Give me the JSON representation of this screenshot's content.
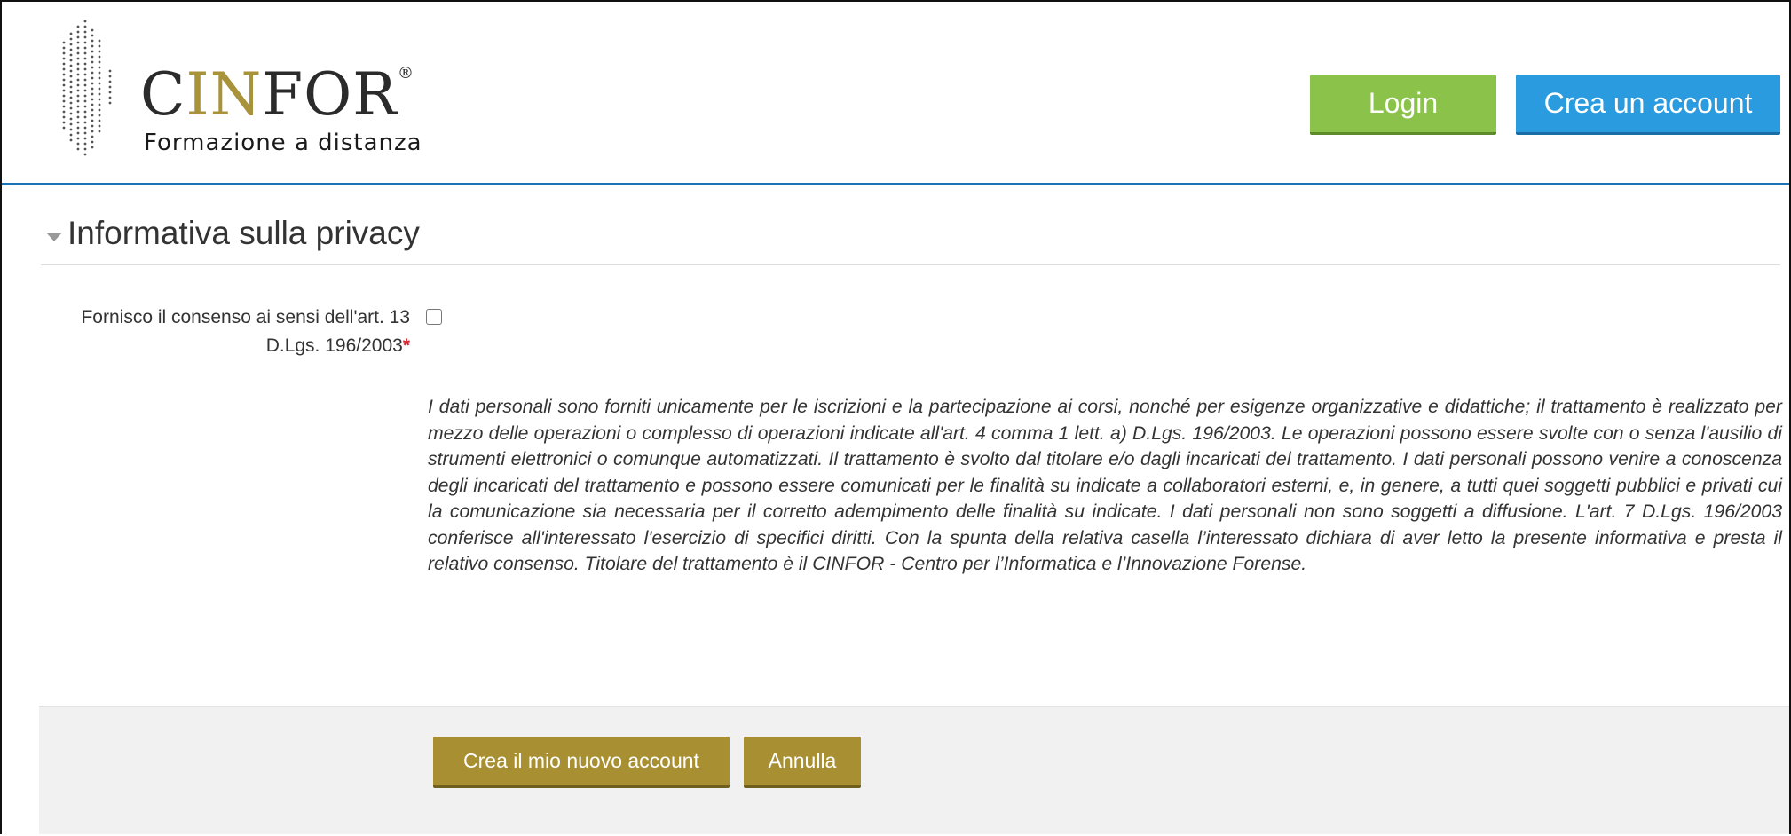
{
  "header": {
    "brand": {
      "name_part1": "C",
      "name_gold": "IN",
      "name_part2": "FOR",
      "registered": "®",
      "tagline": "Formazione a distanza"
    },
    "login_label": "Login",
    "create_account_label": "Crea un account"
  },
  "section": {
    "title": "Informativa sulla privacy"
  },
  "consent": {
    "label": "Fornisco il consenso ai sensi dell'art. 13 D.Lgs. 196/2003",
    "required_mark": "*",
    "checked": false
  },
  "policy_text": "I dati personali sono forniti unicamente per le iscrizioni e la partecipazione ai corsi, nonché per esigenze organizzative e didattiche; il trattamento è realizzato per mezzo delle operazioni o complesso di operazioni indicate all'art. 4 comma 1 lett. a) D.Lgs. 196/2003. Le operazioni possono essere svolte con o senza l'ausilio di strumenti elettronici o comunque automatizzati. Il trattamento è svolto dal titolare e/o dagli incaricati del trattamento. I dati personali possono venire a conoscenza degli incaricati del trattamento e possono essere comunicati per le finalità su indicate a collaboratori esterni, e, in genere, a tutti quei soggetti pubblici e privati cui la comunicazione sia necessaria per il corretto adempimento delle finalità su indicate. I dati personali non sono soggetti a diffusione. L'art. 7 D.Lgs. 196/2003 conferisce all'interessato l'esercizio di specifici diritti. Con la spunta della relativa casella l’interessato dichiara di aver letto la presente informativa e presta il relativo consenso. Titolare del trattamento è il CINFOR - Centro per l’Informatica e l’Innovazione Forense.",
  "actions": {
    "submit_label": "Crea il mio nuovo account",
    "cancel_label": "Annulla"
  },
  "colors": {
    "login": "#8bc34a",
    "create_account": "#2b9be0",
    "brand_gold": "#a8923a",
    "action_gold": "#a89032",
    "header_rule": "#1a73b5",
    "required": "#d9232a"
  }
}
